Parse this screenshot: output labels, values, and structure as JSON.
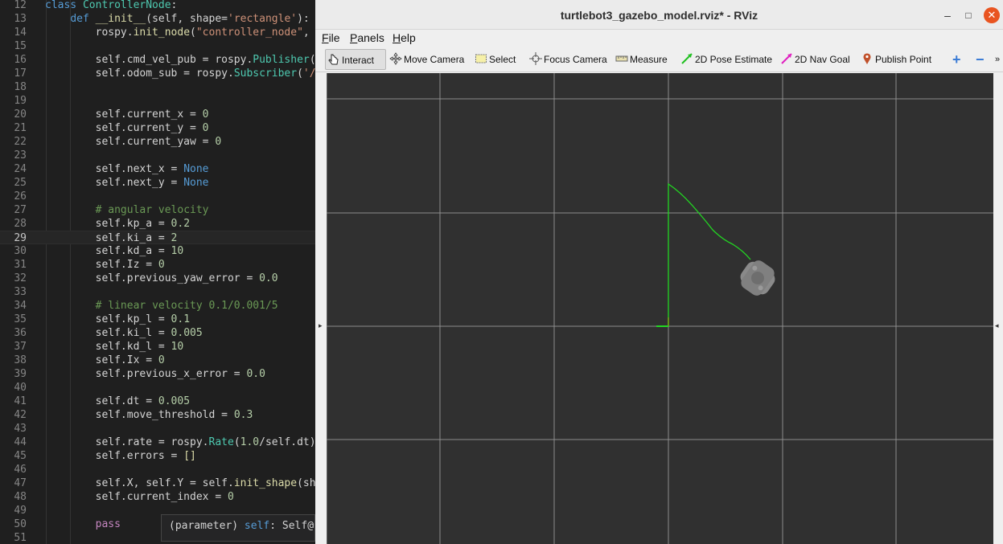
{
  "editor": {
    "lines": [
      {
        "n": "12",
        "html": "<span class=\"tok-kw\">class</span> <span class=\"tok-cls\">ControllerNode</span>:"
      },
      {
        "n": "13",
        "html": "    <span class=\"tok-def\">def</span> <span class=\"tok-fn\">__init__</span>(self, shape=<span class=\"tok-str\">'rectangle'</span>):"
      },
      {
        "n": "14",
        "html": "        rospy.<span class=\"tok-fn\">init_node</span>(<span class=\"tok-str\">\"controller_node\"</span>, a"
      },
      {
        "n": "15",
        "html": ""
      },
      {
        "n": "16",
        "html": "        self.cmd_vel_pub = rospy.<span class=\"tok-cls\">Publisher</span>(<span class=\"tok-str\">\"</span>"
      },
      {
        "n": "17",
        "html": "        self.odom_sub = rospy.<span class=\"tok-cls\">Subscriber</span>(<span class=\"tok-str\">'/o</span>"
      },
      {
        "n": "18",
        "html": ""
      },
      {
        "n": "19",
        "html": ""
      },
      {
        "n": "20",
        "html": "        self.current_x = <span class=\"tok-num\">0</span>"
      },
      {
        "n": "21",
        "html": "        self.current_y = <span class=\"tok-num\">0</span>"
      },
      {
        "n": "22",
        "html": "        self.current_yaw = <span class=\"tok-num\">0</span>"
      },
      {
        "n": "23",
        "html": ""
      },
      {
        "n": "24",
        "html": "        self.next_x = <span class=\"tok-kw\">None</span>"
      },
      {
        "n": "25",
        "html": "        self.next_y = <span class=\"tok-kw\">None</span>"
      },
      {
        "n": "26",
        "html": ""
      },
      {
        "n": "27",
        "html": "        <span class=\"tok-cmt\"># angular velocity</span>"
      },
      {
        "n": "28",
        "html": "        self.kp_a = <span class=\"tok-num\">0.2</span>"
      },
      {
        "n": "29",
        "html": "        self.ki_a = <span class=\"tok-num\">2</span>"
      },
      {
        "n": "30",
        "html": "        self.kd_a = <span class=\"tok-num\">10</span>"
      },
      {
        "n": "31",
        "html": "        self.Iz = <span class=\"tok-num\">0</span>"
      },
      {
        "n": "32",
        "html": "        self.previous_yaw_error = <span class=\"tok-num\">0.0</span>"
      },
      {
        "n": "33",
        "html": ""
      },
      {
        "n": "34",
        "html": "        <span class=\"tok-cmt\"># linear velocity 0.1/0.001/5</span>"
      },
      {
        "n": "35",
        "html": "        self.kp_l = <span class=\"tok-num\">0.1</span>"
      },
      {
        "n": "36",
        "html": "        self.ki_l = <span class=\"tok-num\">0.005</span>"
      },
      {
        "n": "37",
        "html": "        self.kd_l = <span class=\"tok-num\">10</span>"
      },
      {
        "n": "38",
        "html": "        self.Ix = <span class=\"tok-num\">0</span>"
      },
      {
        "n": "39",
        "html": "        self.previous_x_error = <span class=\"tok-num\">0.0</span>"
      },
      {
        "n": "40",
        "html": ""
      },
      {
        "n": "41",
        "html": "        self.dt = <span class=\"tok-num\">0.005</span>"
      },
      {
        "n": "42",
        "html": "        self.move_threshold = <span class=\"tok-num\">0.3</span>"
      },
      {
        "n": "43",
        "html": ""
      },
      {
        "n": "44",
        "html": "        self.rate = rospy.<span class=\"tok-cls\">Rate</span>(<span class=\"tok-num\">1.0</span>/self.dt)"
      },
      {
        "n": "45",
        "html": "        self.errors = <span class=\"tok-fn\">[]</span>"
      },
      {
        "n": "46",
        "html": ""
      },
      {
        "n": "47",
        "html": "        self.X, self.Y = self.<span class=\"tok-fn\">init_shape</span>(shap"
      },
      {
        "n": "48",
        "html": "        self.current_index = <span class=\"tok-num\">0</span>"
      },
      {
        "n": "49",
        "html": ""
      },
      {
        "n": "50",
        "html": "        <span class=\"tok-ctl\">pass</span>"
      },
      {
        "n": "51",
        "html": ""
      }
    ],
    "current_line": "29",
    "hover_tip": {
      "prefix": "(parameter) ",
      "keyword": "self",
      "rest": ": Self@C"
    }
  },
  "rviz": {
    "title": "turtlebot3_gazebo_model.rviz* - RViz",
    "window_buttons": {
      "minimize": "–",
      "maximize": "□",
      "close": "✕"
    },
    "menu": [
      {
        "label": "File",
        "accel": "F",
        "rest": "ile"
      },
      {
        "label": "Panels",
        "accel": "P",
        "rest": "anels"
      },
      {
        "label": "Help",
        "accel": "H",
        "rest": "elp"
      }
    ],
    "tools": [
      {
        "label": "Interact",
        "icon": "hand-pointer-icon",
        "active": true
      },
      {
        "label": "Move Camera",
        "icon": "move-camera-icon",
        "active": false
      },
      {
        "label": "Select",
        "icon": "select-box-icon",
        "active": false
      },
      {
        "label": "Focus Camera",
        "icon": "focus-crosshair-icon",
        "active": false
      },
      {
        "label": "Measure",
        "icon": "ruler-icon",
        "active": false
      },
      {
        "label": "2D Pose Estimate",
        "icon": "green-arrow-icon",
        "active": false
      },
      {
        "label": "2D Nav Goal",
        "icon": "magenta-arrow-icon",
        "active": false
      },
      {
        "label": "Publish Point",
        "icon": "map-pin-icon",
        "active": false
      }
    ],
    "toolbar_extra": {
      "add": "+",
      "remove": "−",
      "more": "»"
    },
    "colors": {
      "grid": "#a0a0a0",
      "path": "#22d822",
      "axis_red": "#e01010",
      "robot": "#8a8a8a",
      "background": "#303030"
    }
  }
}
